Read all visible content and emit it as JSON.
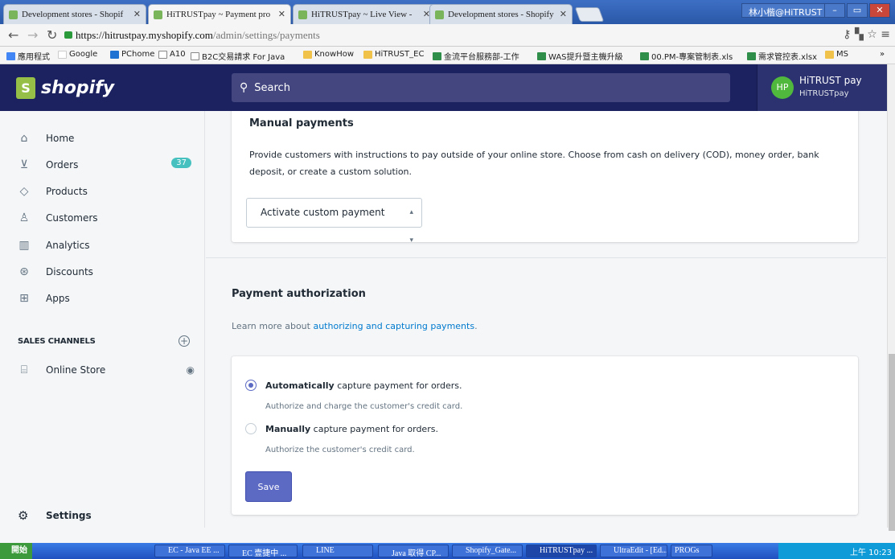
{
  "browser": {
    "tabs": [
      {
        "label": "Development stores - Shopif"
      },
      {
        "label": "HiTRUSTpay ~ Payment pro"
      },
      {
        "label": "HiTRUSTpay ~ Live View -"
      },
      {
        "label": "Development stores - Shopify"
      }
    ],
    "user_label": "林小楷@HiTRUST",
    "url_host": "https://hitrustpay.myshopify.com",
    "url_path": "/admin/settings/payments",
    "bookmarks": [
      "應用程式",
      "Google",
      "PChome",
      "A10",
      "B2C交易請求 For Java",
      "KnowHow",
      "HiTRUST_EC",
      "金流平台服務部-工作",
      "WAS提升暨主機升級",
      "00.PM-專案管制表.xls",
      "需求管控表.xlsx",
      "MS"
    ]
  },
  "topbar": {
    "brand": "shopify",
    "search_placeholder": "Search",
    "avatar_initials": "HP",
    "user_name": "HiTRUST pay",
    "store_name": "HiTRUSTpay"
  },
  "sidebar": {
    "items": [
      {
        "label": "Home"
      },
      {
        "label": "Orders",
        "badge": "37"
      },
      {
        "label": "Products"
      },
      {
        "label": "Customers"
      },
      {
        "label": "Analytics"
      },
      {
        "label": "Discounts"
      },
      {
        "label": "Apps"
      }
    ],
    "sales_channels_heading": "SALES CHANNELS",
    "online_store": "Online Store",
    "settings": "Settings"
  },
  "manual_payments": {
    "title": "Manual payments",
    "description": "Provide customers with instructions to pay outside of your online store. Choose from cash on delivery (COD), money order, bank deposit, or create a custom solution.",
    "select_value": "Activate custom payment"
  },
  "payment_authorization": {
    "title": "Payment authorization",
    "learn_prefix": "Learn more about ",
    "learn_link": "authorizing and capturing payments",
    "learn_suffix": ".",
    "option_auto_bold": "Automatically",
    "option_auto_rest": " capture payment for orders.",
    "option_auto_help": "Authorize and charge the customer's credit card.",
    "option_manual_bold": "Manually",
    "option_manual_rest": " capture payment for orders.",
    "option_manual_help": "Authorize the customer's credit card.",
    "selected": "automatic",
    "save_label": "Save"
  },
  "taskbar": {
    "start": "開始",
    "items": [
      "EC - Java EE ...",
      "EC 壹捷中 ...",
      "LINE",
      "Java 取得 CP...",
      "Shopify_Gate...",
      "HiTRUSTpay ...",
      "UltraEdit - [Ed...",
      "PROGs"
    ],
    "clock": "上午 10:23"
  },
  "colors": {
    "topbar_bg": "#1c2260",
    "primary_button": "#5c6ac4",
    "link": "#007ace",
    "badge": "#47c1bf"
  }
}
